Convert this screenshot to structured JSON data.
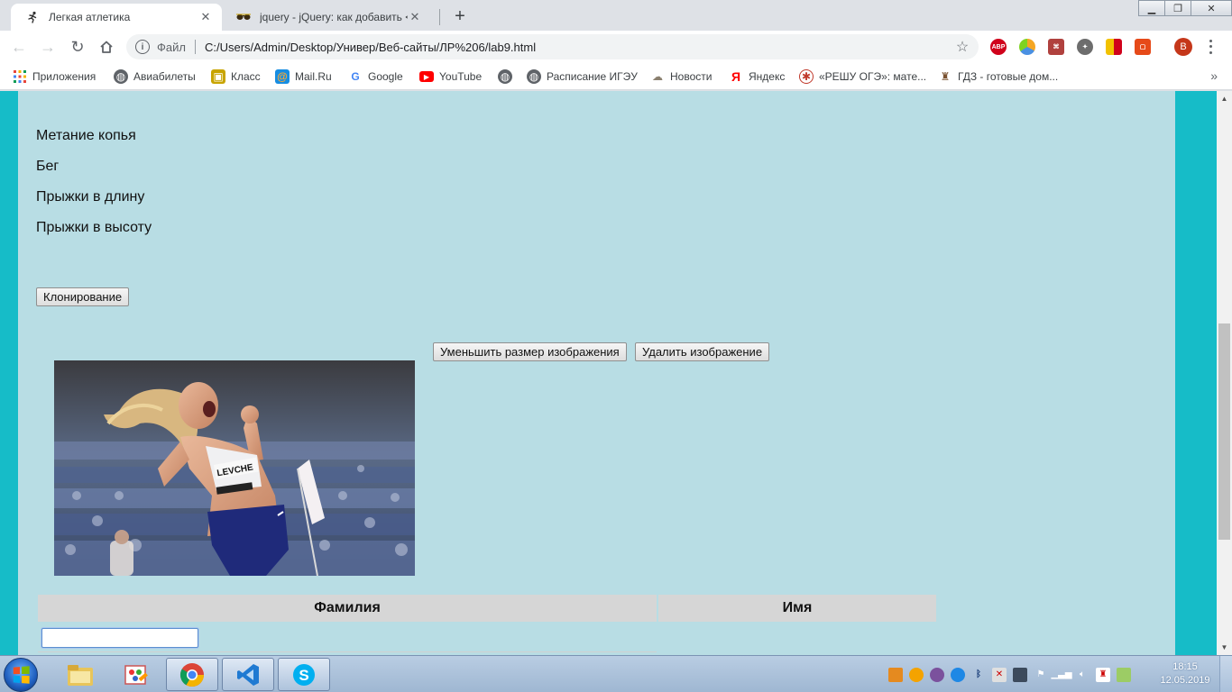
{
  "browser": {
    "tabs": [
      {
        "title": "Легкая атлетика",
        "icon": "runner-icon",
        "active": true
      },
      {
        "title": "jquery - jQuery: как добавить <l",
        "icon": "sunglasses-icon",
        "active": false
      }
    ],
    "address": {
      "scheme_label": "Файл",
      "url": "C:/Users/Admin/Desktop/Универ/Веб-сайты/ЛР%206/lab9.html"
    },
    "profile_initial": "B",
    "extensions": [
      {
        "name": "adblock-icon",
        "label": "ABP",
        "color": "#d0021b"
      },
      {
        "name": "speed-dial-icon",
        "label": "",
        "color": "#f5a623"
      },
      {
        "name": "pdf-icon",
        "label": "",
        "color": "#b0413e"
      },
      {
        "name": "shield-extension-icon",
        "label": "",
        "color": "#6d6d6d"
      },
      {
        "name": "bookmark-extension-icon",
        "label": "",
        "color": "#f2c200"
      },
      {
        "name": "office-icon",
        "label": "",
        "color": "#e64a19"
      }
    ]
  },
  "bookmarks": [
    {
      "label": "Приложения",
      "icon": "apps-grid-icon"
    },
    {
      "label": "Авиабилеты",
      "icon": "globe-icon"
    },
    {
      "label": "Класс",
      "icon": "class-icon"
    },
    {
      "label": "Mail.Ru",
      "icon": "mailru-icon"
    },
    {
      "label": "Google",
      "icon": "google-icon"
    },
    {
      "label": "YouTube",
      "icon": "youtube-icon"
    },
    {
      "label": "",
      "icon": "globe-icon"
    },
    {
      "label": "Расписание ИГЭУ",
      "icon": "globe-icon"
    },
    {
      "label": "Новости",
      "icon": "news-icon"
    },
    {
      "label": "Яндекс",
      "icon": "yandex-icon"
    },
    {
      "label": "«РЕШУ ОГЭ»: мате...",
      "icon": "reshu-icon"
    },
    {
      "label": "ГДЗ - готовые дом...",
      "icon": "gdz-icon"
    }
  ],
  "page": {
    "sports": [
      "Метание копья",
      "Бег",
      "Прыжки в длину",
      "Прыжки в высоту"
    ],
    "clone_button": "Клонирование",
    "shrink_button": "Уменьшить размер изображения",
    "delete_button": "Удалить изображение",
    "table": {
      "headers": [
        "Фамилия",
        "Имя"
      ],
      "first_input_value": ""
    },
    "colors": {
      "outer_background": "#16bcc8",
      "content_background": "#b8dde4"
    }
  },
  "taskbar": {
    "apps": [
      "windows-explorer-icon",
      "paint-icon",
      "chrome-icon",
      "vscode-icon",
      "skype-icon"
    ],
    "time": "18:15",
    "date": "12.05.2019"
  }
}
